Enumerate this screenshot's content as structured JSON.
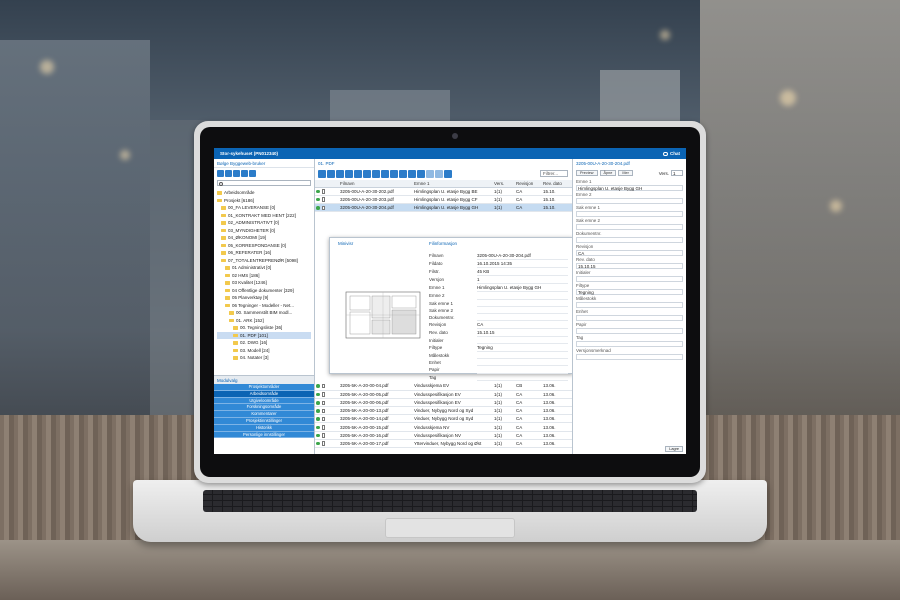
{
  "app": {
    "title": "Stor-sykehuset (PN012340)",
    "chat_label": "Chat"
  },
  "left_panel": {
    "header": "Bølge Byggeweb-bruker",
    "tree": [
      {
        "label": "Arbeidsområde",
        "depth": 0
      },
      {
        "label": "Prosjekt [6186]",
        "depth": 0
      },
      {
        "label": "00_FA LEVERANSE [0]",
        "depth": 1
      },
      {
        "label": "01_KONTRAKT MED HENT [222]",
        "depth": 1
      },
      {
        "label": "02_ADMINISTRATIVT [0]",
        "depth": 1
      },
      {
        "label": "03_MYNDIGHETER [0]",
        "depth": 1
      },
      {
        "label": "04_ØKONOMI [19]",
        "depth": 1
      },
      {
        "label": "05_KORRESPONDANSE [0]",
        "depth": 1
      },
      {
        "label": "06_REFERATER [16]",
        "depth": 1
      },
      {
        "label": "07_TOTALENTREPRENØR [5098]",
        "depth": 1
      },
      {
        "label": "01 Administrativt [0]",
        "depth": 2
      },
      {
        "label": "02 HMS [186]",
        "depth": 2
      },
      {
        "label": "03 Kvalitet [1246]",
        "depth": 2
      },
      {
        "label": "04 Offentlige dokumenter [329]",
        "depth": 2
      },
      {
        "label": "05 Planverktøy [9]",
        "depth": 2
      },
      {
        "label": "06 Tegninger - Modeller - Net...",
        "depth": 2
      },
      {
        "label": "00. Sammenstilt BIM modl...",
        "depth": 3
      },
      {
        "label": "01. ARK [152]",
        "depth": 3
      },
      {
        "label": "00. Tegningsliste [36]",
        "depth": 4
      },
      {
        "label": "01. PDF [101]",
        "depth": 4,
        "selected": true
      },
      {
        "label": "02. DWG [16]",
        "depth": 4
      },
      {
        "label": "03. Modell [24]",
        "depth": 4
      },
      {
        "label": "04. Notater [3]",
        "depth": 4
      }
    ],
    "modules_header": "Modulvalg",
    "modules": [
      "Prosjektområder",
      "Arbeidsområde",
      "Utgiveloområde",
      "Forskningsområde",
      "Kommentarer",
      "Prosjektinnstillinger",
      "Historikk",
      "Personlige innstillinger"
    ],
    "active_module": "Arbeidsområde"
  },
  "center_panel": {
    "header": "01. PDF",
    "filter_placeholder": "Filtrer...",
    "columns": [
      "Filnavn",
      "Emne 1",
      "Vers.",
      "Revisjon",
      "Rev. dato"
    ],
    "rows_top": [
      {
        "file": "3205-00U-A-20-30-202.pdf",
        "subject": "Himlingsplan U. etasje Bygg BE",
        "vers": "1(1)",
        "rev": "CA",
        "date": "15.10."
      },
      {
        "file": "3205-00U-A-20-30-203.pdf",
        "subject": "Himlingsplan U. etasje Bygg CF",
        "vers": "1(1)",
        "rev": "CA",
        "date": "15.10."
      },
      {
        "file": "3205-00U-A-20-30-204.pdf",
        "subject": "Himlingsplan U. etasje Bygg GH",
        "vers": "1(1)",
        "rev": "CA",
        "date": "15.10.",
        "highlight": true
      }
    ],
    "rows_bottom": [
      {
        "file": "3205-5K-A-20-00-04.pdf",
        "subject": "Vindusskjema EV",
        "vers": "1(1)",
        "rev": "CB",
        "date": "13.06."
      },
      {
        "file": "3205-5K-A-20-00-05.pdf",
        "subject": "Vindusspesifikasjon EV",
        "vers": "1(1)",
        "rev": "CA",
        "date": "13.06."
      },
      {
        "file": "3205-5K-A-20-00-06.pdf",
        "subject": "Vindusspesifikasjon EV",
        "vers": "1(1)",
        "rev": "CA",
        "date": "13.06."
      },
      {
        "file": "3205-5K-A-20-00-13.pdf",
        "subject": "Vinduer, Nybygg Nord og Syd",
        "vers": "1(1)",
        "rev": "CA",
        "date": "13.06."
      },
      {
        "file": "3205-5K-A-20-00-14.pdf",
        "subject": "Vinduer, Nybygg Nord og Syd",
        "vers": "1(1)",
        "rev": "CA",
        "date": "13.06."
      },
      {
        "file": "3205-5K-A-20-00-15.pdf",
        "subject": "Vindusskjema NV",
        "vers": "1(1)",
        "rev": "CA",
        "date": "13.06."
      },
      {
        "file": "3205-5K-A-20-00-16.pdf",
        "subject": "Vindusspesifikasjon NV",
        "vers": "1(1)",
        "rev": "CA",
        "date": "13.06."
      },
      {
        "file": "3205-5K-A-20-00-17.pdf",
        "subject": "Yttervinduer, Nybygg Nord og Øst",
        "vers": "1(1)",
        "rev": "CA",
        "date": "13.06."
      }
    ],
    "popup": {
      "preview_label": "Minivisr",
      "info_label": "Filinformasjon",
      "properties": [
        {
          "key": "Filnavn",
          "value": "3205-00U-A-20-30-204.pdf"
        },
        {
          "key": "Fildato",
          "value": "16.10.2015 14:35"
        },
        {
          "key": "Filstr.",
          "value": "45 KB"
        },
        {
          "key": "Versjon",
          "value": "1"
        },
        {
          "key": "Emne 1",
          "value": "Himlingsplan U. etasje Bygg GH"
        },
        {
          "key": "Emne 2",
          "value": ""
        },
        {
          "key": "Sak emne 1",
          "value": ""
        },
        {
          "key": "Sak emne 2",
          "value": ""
        },
        {
          "key": "Dokumentnr.",
          "value": ""
        },
        {
          "key": "Revisjon",
          "value": "CA"
        },
        {
          "key": "Rev. dato",
          "value": "15.10.15"
        },
        {
          "key": "Initialer",
          "value": ""
        },
        {
          "key": "Filtype",
          "value": "Tegning"
        },
        {
          "key": "Målestokk",
          "value": ""
        },
        {
          "key": "Enhet",
          "value": ""
        },
        {
          "key": "Papir",
          "value": ""
        },
        {
          "key": "Tag",
          "value": ""
        }
      ]
    }
  },
  "right_panel": {
    "header": "3205-00U-A-20-30-204.pdf",
    "buttons": [
      "Preview",
      "Åpne",
      "Mer"
    ],
    "version_label": "Vers.",
    "version_value": "1",
    "fields": [
      {
        "label": "Emne 1",
        "value": "Himlingsplan U. etasje Bygg GH"
      },
      {
        "label": "Emne 2",
        "value": ""
      },
      {
        "label": "Sak emne 1",
        "value": ""
      },
      {
        "label": "Sak emne 2",
        "value": ""
      },
      {
        "label": "Dokumentnr.",
        "value": ""
      },
      {
        "label": "Revisjon",
        "value": "CA"
      },
      {
        "label": "Rev. dato",
        "value": "15.10.15"
      },
      {
        "label": "Initialer",
        "value": ""
      },
      {
        "label": "Filtype",
        "value": "Tegning"
      },
      {
        "label": "Målestokk",
        "value": ""
      },
      {
        "label": "Enhet",
        "value": ""
      },
      {
        "label": "Papir",
        "value": ""
      },
      {
        "label": "Tag",
        "value": ""
      },
      {
        "label": "Versjonsmerknad",
        "value": ""
      }
    ],
    "save_label": "Lagre"
  }
}
